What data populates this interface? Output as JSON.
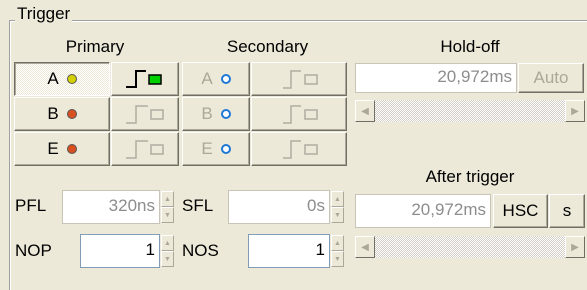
{
  "group_title": "Trigger",
  "primary": {
    "heading": "Primary",
    "rows": [
      {
        "label": "A",
        "dot_color": "#d4d000"
      },
      {
        "label": "B",
        "dot_color": "#d85020"
      },
      {
        "label": "E",
        "dot_color": "#d85020"
      }
    ],
    "field_label": "PFL",
    "field_value": "320ns",
    "count_label": "NOP",
    "count_value": "1"
  },
  "secondary": {
    "heading": "Secondary",
    "rows": [
      {
        "label": "A"
      },
      {
        "label": "B"
      },
      {
        "label": "E"
      }
    ],
    "field_label": "SFL",
    "field_value": "0s",
    "count_label": "NOS",
    "count_value": "1"
  },
  "holdoff": {
    "heading": "Hold-off",
    "value": "20,972ms",
    "auto_label": "Auto"
  },
  "after_trigger": {
    "heading": "After trigger",
    "value": "20,972ms",
    "hsc_label": "HSC",
    "s_label": "s"
  },
  "colors": {
    "active_edge_indicator": "#00d000",
    "inactive_icon": "#b0aca0",
    "hollow_dot": "#1e78d6"
  },
  "icons": [
    "rising-edge-icon",
    "edge-outline-icon",
    "led-dot-icon",
    "spin-up-icon",
    "spin-down-icon",
    "scroll-left-icon",
    "scroll-right-icon"
  ]
}
